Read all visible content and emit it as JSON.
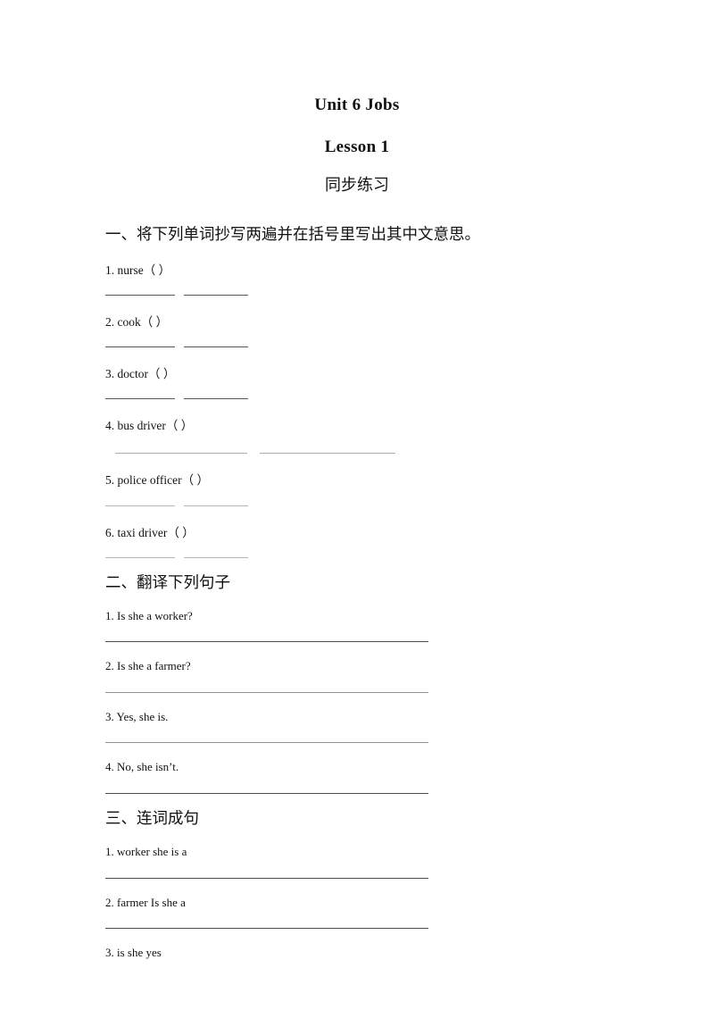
{
  "document": {
    "title": "Unit 6 Jobs",
    "subtitle": "Lesson 1",
    "subtitle2": "同步练习"
  },
  "sections": [
    {
      "heading": "一、将下列单词抄写两遍并在括号里写出其中文意思。",
      "items": [
        {
          "text": "1. nurse（      ）"
        },
        {
          "text": "2. cook（      ）"
        },
        {
          "text": "3. doctor（      ）"
        },
        {
          "text": "4. bus driver（      ）"
        },
        {
          "text": "5. police officer（      ）"
        },
        {
          "text": "6. taxi driver（      ）"
        }
      ]
    },
    {
      "heading": "二、翻译下列句子",
      "items": [
        {
          "text": "1. Is she a worker?"
        },
        {
          "text": "2. Is she a farmer?"
        },
        {
          "text": "3. Yes, she is."
        },
        {
          "text": "4. No, she isn’t."
        }
      ]
    },
    {
      "heading": "三、连词成句",
      "items": [
        {
          "text": "1. worker she is a"
        },
        {
          "text": "2. farmer Is she a"
        },
        {
          "text": "3. is she yes"
        }
      ]
    }
  ],
  "colors": {
    "page_background": "#ffffff",
    "text": "#111111",
    "rule_dark": "#4c5054",
    "rule_mid": "#8e9296",
    "rule_light": "#b3b7ba"
  }
}
